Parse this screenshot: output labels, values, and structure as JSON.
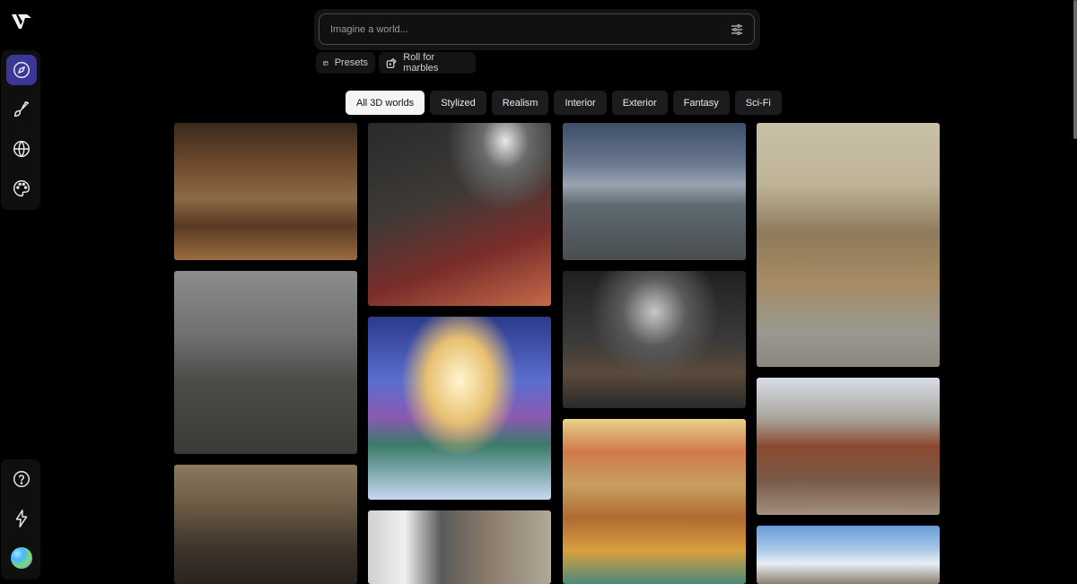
{
  "search": {
    "placeholder": "Imagine a world..."
  },
  "actions": {
    "presets_label": "Presets",
    "roll_label": "Roll for marbles"
  },
  "tabs": [
    {
      "label": "All 3D worlds",
      "active": true
    },
    {
      "label": "Stylized"
    },
    {
      "label": "Realism"
    },
    {
      "label": "Interior"
    },
    {
      "label": "Exterior"
    },
    {
      "label": "Fantasy"
    },
    {
      "label": "Sci-Fi"
    }
  ],
  "sidebar": {
    "top_items": [
      "compass-icon",
      "brush-icon",
      "globe-icon",
      "palette-icon"
    ],
    "bottom_items": [
      "help-icon",
      "lightning-icon",
      "avatar"
    ]
  },
  "colors": {
    "active_nav": "#3b3796",
    "active_tab": "#f4f4f4",
    "background": "#000000"
  },
  "gallery": [
    "cozy wooden shop interior with shelves and table",
    "dark arcade room with glowing machines",
    "industrial courtyard with fences under stormy sky",
    "office storage room with boxes and filing cabinets",
    "ruined abandoned city street",
    "fantasy golden archway with tree and rainbow wings above clouds",
    "sci-fi spaceship corridor",
    "colorful retro cabin interior with armchair",
    "train station platform with red brick buildings",
    "gothic cathedral archway interior",
    "industrial loft with large windows",
    "snowy mountain landscape"
  ]
}
